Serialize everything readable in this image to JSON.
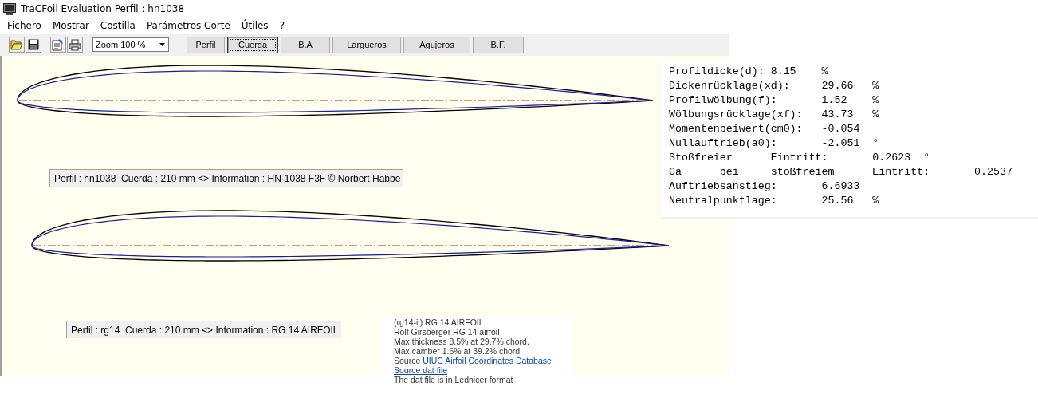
{
  "window": {
    "title": "TraCFoil Evaluation Perfil : hn1038"
  },
  "menu": [
    "Fichero",
    "Mostrar",
    "Costilla",
    "Parámetros Corte",
    "Útiles",
    "?"
  ],
  "toolbar": {
    "zoom": "Zoom 100 %",
    "tabs": [
      {
        "label": "Perfil",
        "selected": false
      },
      {
        "label": "Cuerda",
        "selected": true
      },
      {
        "label": "B.A",
        "selected": false
      },
      {
        "label": "Largueros",
        "selected": false
      },
      {
        "label": "Agujeros",
        "selected": false
      },
      {
        "label": "B.F.",
        "selected": false
      }
    ]
  },
  "profiles": [
    {
      "caption": "Perfil : hn1038  Cuerda : 210 mm <> Information : HN-1038 F3F © Norbert Habbe"
    },
    {
      "caption": "Perfil : rg14  Cuerda : 210 mm <> Information : RG 14 AIRFOIL"
    }
  ],
  "analysis": {
    "lines": [
      "Profildicke(d): 8.15    %",
      "Dickenrücklage(xd):     29.66   %",
      "Profilwölbung(f):       1.52    %",
      "Wölbungsrücklage(xf):   43.73   %",
      "Momentenbeiwert(cm0):   -0.054",
      "Nullauftrieb(a0):       -2.051  °",
      "Stoßfreier      Eintritt:       0.2623  °",
      "Ca      bei     stoßfreiem      Eintritt:       0.2537",
      "Auftriebsanstieg:       6.6933",
      "Neutralpunktlage:       25.56   %"
    ]
  },
  "info": {
    "lines": [
      {
        "kind": "text",
        "text": "(rg14-il) RG 14 AIRFOIL"
      },
      {
        "kind": "text",
        "text": "Rolf Girsberger RG 14 airfoil"
      },
      {
        "kind": "text",
        "text": "Max thickness 8.5% at 29.7% chord."
      },
      {
        "kind": "text",
        "text": "Max camber 1.6% at 39.2% chord"
      },
      {
        "kind": "source",
        "text": "Source",
        "link": "UIUC Airfoil Coordinates Database"
      },
      {
        "kind": "link",
        "link": "Source dat file"
      },
      {
        "kind": "text",
        "text": "The dat file is in Lednicer format"
      }
    ]
  }
}
